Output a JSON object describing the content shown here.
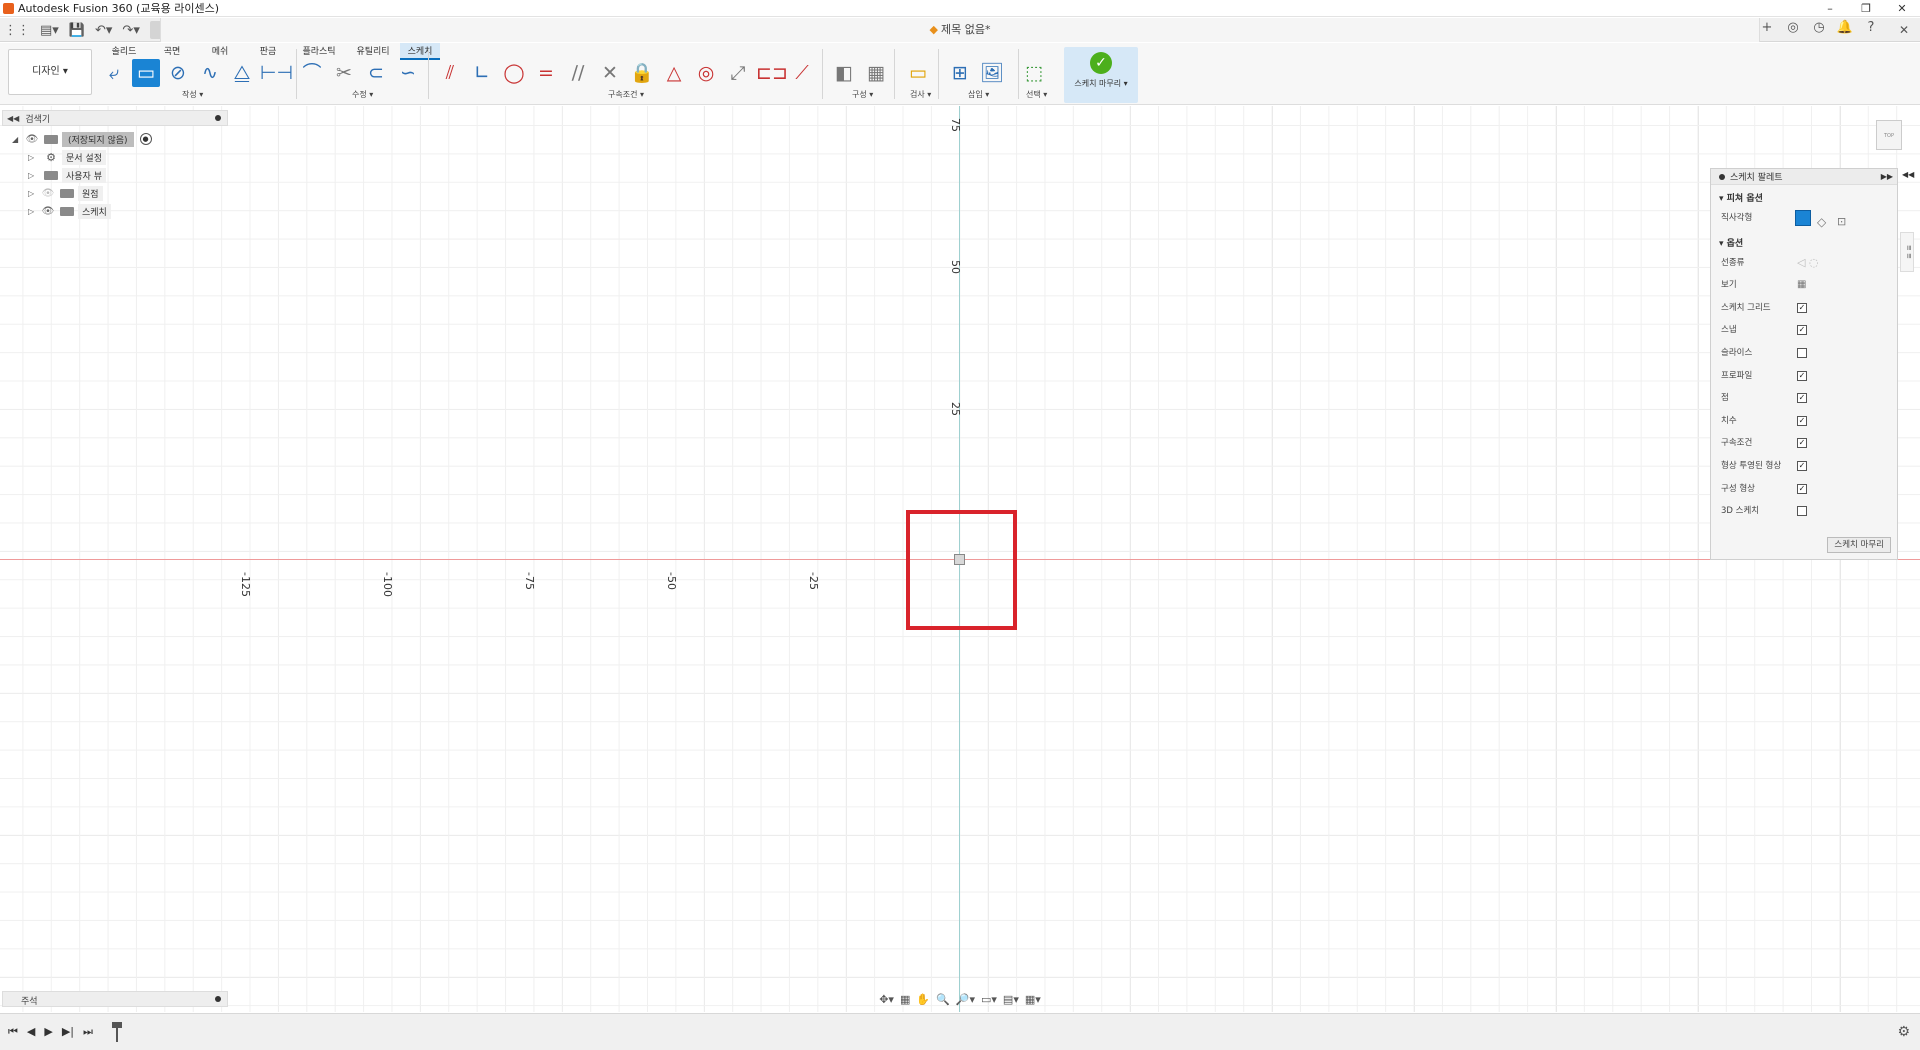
{
  "window": {
    "title": "Autodesk Fusion 360 (교육용 라이센스)",
    "minimize": "–",
    "restore": "❐",
    "close": "✕"
  },
  "document": {
    "tab_title": "제목 없음*",
    "close": "✕"
  },
  "ribbon": {
    "workspace": "디자인 ▾",
    "tabs": [
      "솔리드",
      "곡면",
      "메쉬",
      "판금",
      "플라스틱",
      "유틸리티",
      "스케치"
    ],
    "active_tab": "스케치",
    "groups": {
      "create": "작성 ▾",
      "modify": "수정 ▾",
      "constraints": "구속조건 ▾",
      "construct": "구성 ▾",
      "inspect": "검사 ▾",
      "insert": "삽입 ▾",
      "select": "선택 ▾",
      "finish": "스케치 마무리 ▾"
    }
  },
  "browser": {
    "title": "검색기",
    "root": "(저장되지 않음)",
    "items": [
      "문서 설정",
      "사용자 뷰",
      "원점",
      "스케치"
    ]
  },
  "canvas": {
    "x_ticks": [
      "-125",
      "-100",
      "-75",
      "-50",
      "-25"
    ],
    "y_ticks": [
      "75",
      "50",
      "25"
    ]
  },
  "sketch_palette": {
    "title": "스케치 팔레트",
    "section_feature": "피쳐 옵션",
    "rectangle_label": "직사각형",
    "section_options": "옵션",
    "options": [
      {
        "label": "선종류",
        "checked": null
      },
      {
        "label": "보기",
        "checked": null
      },
      {
        "label": "스케치 그리드",
        "checked": true
      },
      {
        "label": "스냅",
        "checked": true
      },
      {
        "label": "슬라이스",
        "checked": false
      },
      {
        "label": "프로파일",
        "checked": true
      },
      {
        "label": "점",
        "checked": true
      },
      {
        "label": "치수",
        "checked": true
      },
      {
        "label": "구속조건",
        "checked": true
      },
      {
        "label": "형상 투영된 형상",
        "checked": true
      },
      {
        "label": "구성 형상",
        "checked": true
      },
      {
        "label": "3D 스케치",
        "checked": false
      }
    ],
    "finish_button": "스케치 마무리"
  },
  "notes": {
    "title": "주석"
  }
}
